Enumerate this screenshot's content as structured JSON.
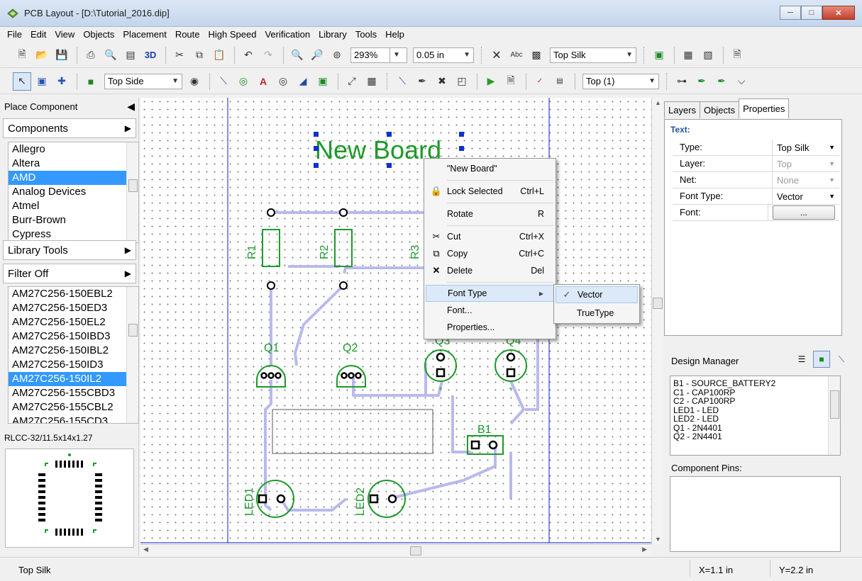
{
  "window": {
    "title": "PCB Layout - [D:\\Tutorial_2016.dip]",
    "icon": "pcb-app-icon",
    "controls": [
      "minimize",
      "maximize",
      "close"
    ]
  },
  "menu": [
    "File",
    "Edit",
    "View",
    "Objects",
    "Placement",
    "Route",
    "High Speed",
    "Verification",
    "Library",
    "Tools",
    "Help"
  ],
  "toolbar1": {
    "label_3d": "3D",
    "zoom": "293%",
    "grid": "0.05 in",
    "abc_label": "Abc",
    "layer": "Top Silk"
  },
  "toolbar2": {
    "side": "Top Side",
    "layer_filter": "Top (1)"
  },
  "left_panel": {
    "header": "Place Component",
    "components_btn": "Components",
    "manufacturers": [
      "Allegro",
      "Altera",
      "AMD",
      "Analog Devices",
      "Atmel",
      "Burr-Brown",
      "Cypress"
    ],
    "selected_manufacturer": "AMD",
    "library_tools_btn": "Library Tools",
    "filter_btn": "Filter Off",
    "parts": [
      "AM27C256-150EBL2",
      "AM27C256-150ED3",
      "AM27C256-150EL2",
      "AM27C256-150IBD3",
      "AM27C256-150IBL2",
      "AM27C256-150ID3",
      "AM27C256-150IL2",
      "AM27C256-155CBD3",
      "AM27C256-155CBL2",
      "AM27C256-155CD3"
    ],
    "selected_part": "AM27C256-150IL2",
    "package": "RLCC-32/11.5x14x1.27"
  },
  "canvas": {
    "board_text": "New Board",
    "labels": {
      "r1": "R1",
      "r2": "R2",
      "r3": "R3",
      "q1": "Q1",
      "q2": "Q2",
      "q3": "Q3",
      "q4": "Q4",
      "b1": "B1",
      "led1": "LED1",
      "led2": "LED2"
    }
  },
  "context_menu": {
    "title_item": "\"New Board\"",
    "items": [
      {
        "label": "Lock Selected",
        "shortcut": "Ctrl+L",
        "icon": "lock-icon"
      },
      {
        "label": "Rotate",
        "shortcut": "R"
      },
      {
        "label": "Cut",
        "shortcut": "Ctrl+X",
        "icon": "scissors-icon"
      },
      {
        "label": "Copy",
        "shortcut": "Ctrl+C",
        "icon": "copy-icon"
      },
      {
        "label": "Delete",
        "shortcut": "Del",
        "icon": "delete-x-icon"
      },
      {
        "label": "Font Type",
        "submenu": true
      },
      {
        "label": "Font..."
      },
      {
        "label": "Properties..."
      }
    ],
    "submenu": {
      "items": [
        "Vector",
        "TrueType"
      ],
      "checked": "Vector"
    }
  },
  "right_panel": {
    "tabs": [
      "Layers",
      "Objects",
      "Properties"
    ],
    "active_tab": "Properties",
    "section_title": "Text:",
    "properties": [
      {
        "name": "Type:",
        "value": "Top Silk",
        "enabled": true,
        "dropdown": true
      },
      {
        "name": "Layer:",
        "value": "Top",
        "enabled": false,
        "dropdown": true
      },
      {
        "name": "Net:",
        "value": "None",
        "enabled": false,
        "dropdown": true
      },
      {
        "name": "Font Type:",
        "value": "Vector",
        "enabled": true,
        "dropdown": true
      },
      {
        "name": "Font:",
        "value": "...",
        "enabled": true,
        "button": true
      }
    ],
    "design_manager": {
      "title": "Design Manager",
      "items": [
        "B1 - SOURCE_BATTERY2",
        "C1 - CAP100RP",
        "C2 - CAP100RP",
        "LED1 - LED",
        "LED2 - LED",
        "Q1 - 2N4401",
        "Q2 - 2N4401"
      ],
      "component_pins_label": "Component Pins:"
    }
  },
  "status": {
    "layer": "Top Silk",
    "x": "X=1.1 in",
    "y": "Y=2.2 in"
  },
  "colors": {
    "silk": "#1d9a2a",
    "trace": "#b9b9ef",
    "board_edge": "#3246c8",
    "selection": "#3399ff",
    "handles": "#1030d0"
  }
}
